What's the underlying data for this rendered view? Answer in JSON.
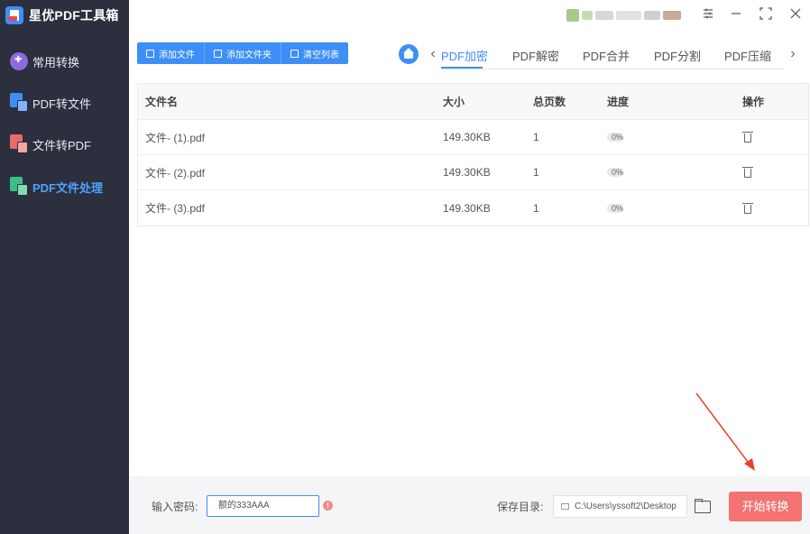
{
  "app": {
    "title": "星优PDF工具箱"
  },
  "sidebar": {
    "items": [
      {
        "label": "常用转换",
        "icon": "grid-icon",
        "active": false
      },
      {
        "label": "PDF转文件",
        "icon": "pdf-to-file-icon",
        "active": false
      },
      {
        "label": "文件转PDF",
        "icon": "file-to-pdf-icon",
        "active": false
      },
      {
        "label": "PDF文件处理",
        "icon": "pdf-process-icon",
        "active": true
      }
    ]
  },
  "window_controls": [
    "settings-icon",
    "minimize-icon",
    "maximize-icon",
    "close-icon"
  ],
  "toolbar": {
    "add_file": "添加文件",
    "add_folder": "添加文件夹",
    "clear_list": "清空列表"
  },
  "tabs": [
    {
      "label": "PDF加密",
      "active": true
    },
    {
      "label": "PDF解密",
      "active": false
    },
    {
      "label": "PDF合并",
      "active": false
    },
    {
      "label": "PDF分割",
      "active": false
    },
    {
      "label": "PDF压缩",
      "active": false
    }
  ],
  "table": {
    "headers": {
      "name": "文件名",
      "size": "大小",
      "pages": "总页数",
      "progress": "进度",
      "ops": "操作"
    },
    "rows": [
      {
        "name": "文件- (1).pdf",
        "size": "149.30KB",
        "pages": "1",
        "progress": "0%",
        "progress_value": 0
      },
      {
        "name": "文件- (2).pdf",
        "size": "149.30KB",
        "pages": "1",
        "progress": "0%",
        "progress_value": 0
      },
      {
        "name": "文件- (3).pdf",
        "size": "149.30KB",
        "pages": "1",
        "progress": "0%",
        "progress_value": 0
      }
    ]
  },
  "bottom": {
    "password_label": "输入密码:",
    "password_value": "额的333AAA",
    "info_symbol": "!",
    "save_label": "保存目录:",
    "save_path": "C:\\Users\\yssoft2\\Desktop",
    "start_label": "开始转换"
  },
  "colors": {
    "accent": "#3e8ef7",
    "sidebar_bg": "#2b2f3e",
    "start_button": "#f37272",
    "annotation_arrow": "#e8412c"
  }
}
